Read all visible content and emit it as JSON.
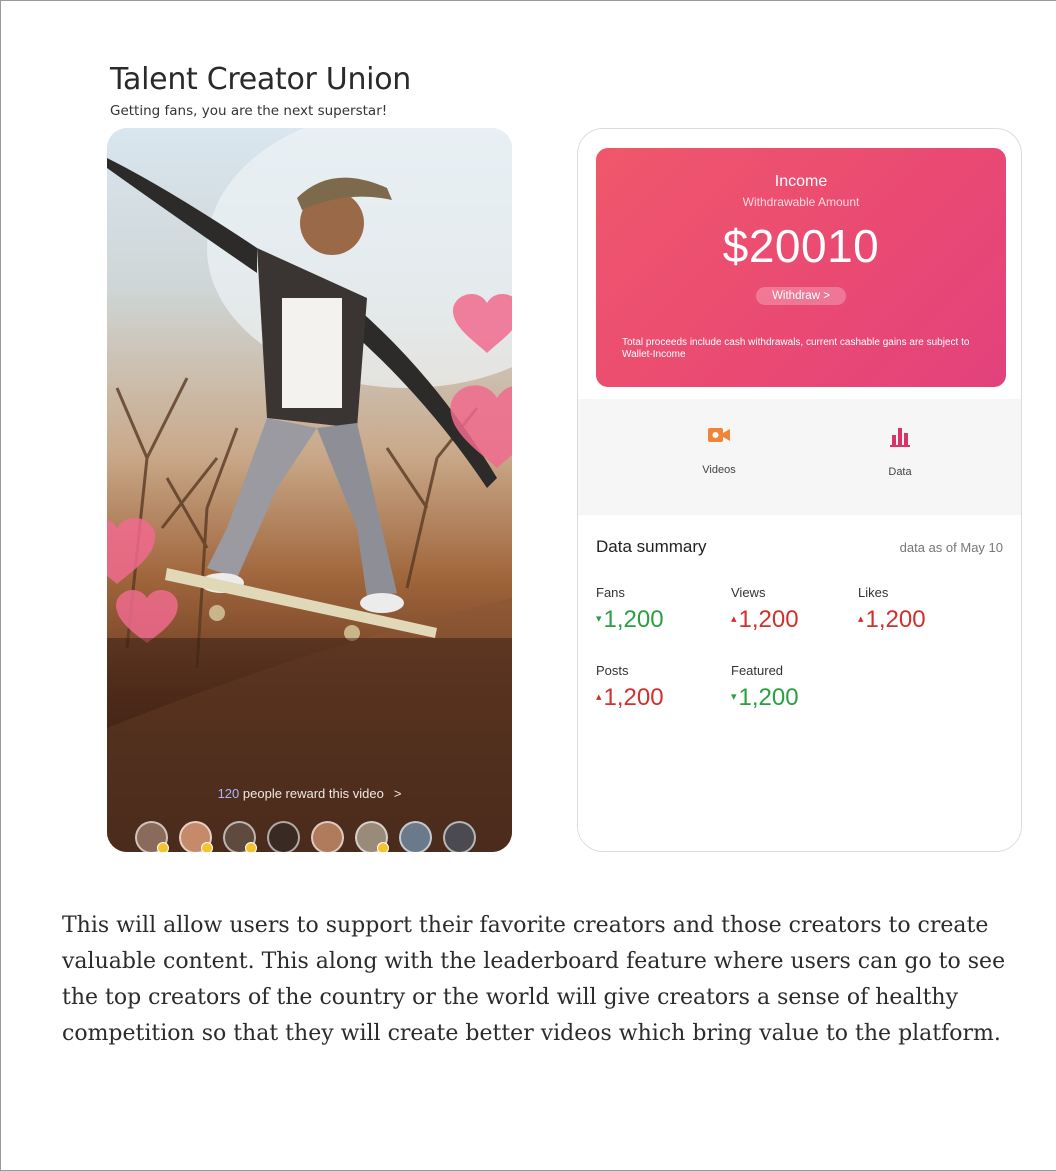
{
  "header": {
    "title": "Talent Creator Union",
    "subtitle": "Getting fans, you are the next superstar!"
  },
  "video": {
    "reward_count": "120",
    "reward_text": " people reward this video",
    "reward_chevron": ">"
  },
  "income": {
    "title": "Income",
    "subtitle": "Withdrawable Amount",
    "amount": "$20010",
    "withdraw_label": "Withdraw >",
    "note": "Total proceeds include cash withdrawals, current cashable gains are subject to Wallet-Income"
  },
  "tools": [
    {
      "label": "Videos",
      "icon": "video-camera-icon",
      "color": "#f0853a"
    },
    {
      "label": "Data",
      "icon": "bar-chart-icon",
      "color": "#d9336a"
    }
  ],
  "summary": {
    "title": "Data summary",
    "date": "data as of May 10",
    "stats": [
      {
        "label": "Fans",
        "value": "1,200",
        "trend": "down"
      },
      {
        "label": "Views",
        "value": "1,200",
        "trend": "up"
      },
      {
        "label": "Likes",
        "value": "1,200",
        "trend": "up"
      },
      {
        "label": "Posts",
        "value": "1,200",
        "trend": "up"
      },
      {
        "label": "Featured",
        "value": "1,200",
        "trend": "down"
      }
    ]
  },
  "caption": "This will allow users to support their favorite creators and those creators to create valuable content. This along with the leaderboard feature where users can go to see the top creators of the country or the world will give creators a sense of healthy competition so that they will create better videos which bring value to the platform.",
  "colors": {
    "income_gradient_start": "#f0576b",
    "income_gradient_end": "#e2427c",
    "trend_up": "#d0312d",
    "trend_down": "#2aa043"
  }
}
